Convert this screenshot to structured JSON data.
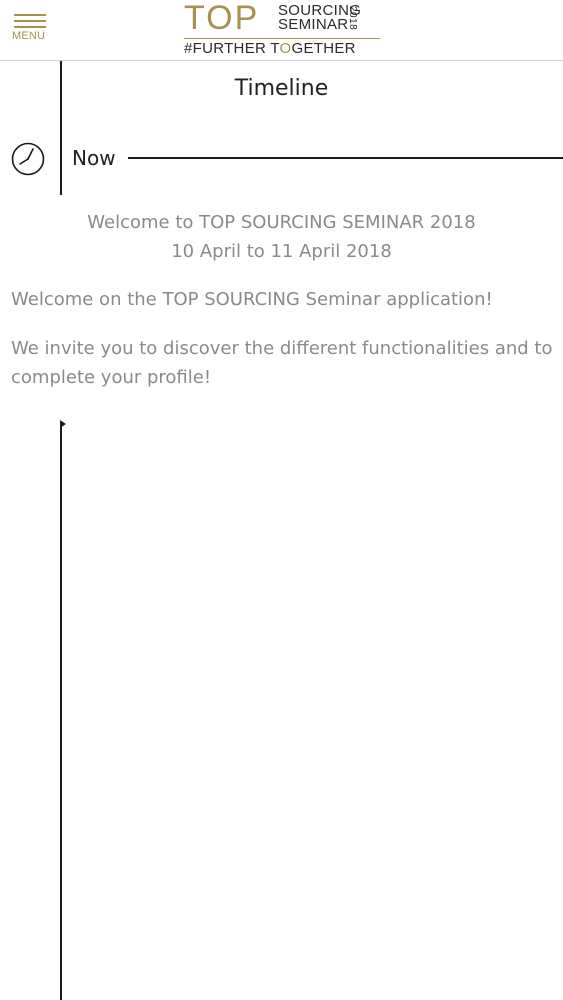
{
  "header": {
    "menu_label": "MENU",
    "logo": {
      "word": "TOP",
      "sub_line1": "SOURCING",
      "sub_line2": "SEMINAR",
      "year": "2018",
      "tagline_part1": "#FURTHER T",
      "tagline_part2": "O",
      "tagline_part3": "GETHER"
    }
  },
  "timeline": {
    "title": "Timeline",
    "now_label": "Now"
  },
  "content": {
    "welcome_line1": "Welcome to TOP SOURCING SEMINAR 2018",
    "welcome_line2": "10 April to 11 April 2018",
    "paragraph1": "Welcome on the TOP SOURCING Seminar application!",
    "paragraph2": "We invite you to discover the different functionalities and to complete your profile!"
  },
  "colors": {
    "brand_gold": "#a8914e",
    "text_dark": "#222222",
    "text_muted": "#8a8a8a"
  },
  "icons": {
    "menu": "hamburger-icon",
    "now": "clock-icon"
  }
}
